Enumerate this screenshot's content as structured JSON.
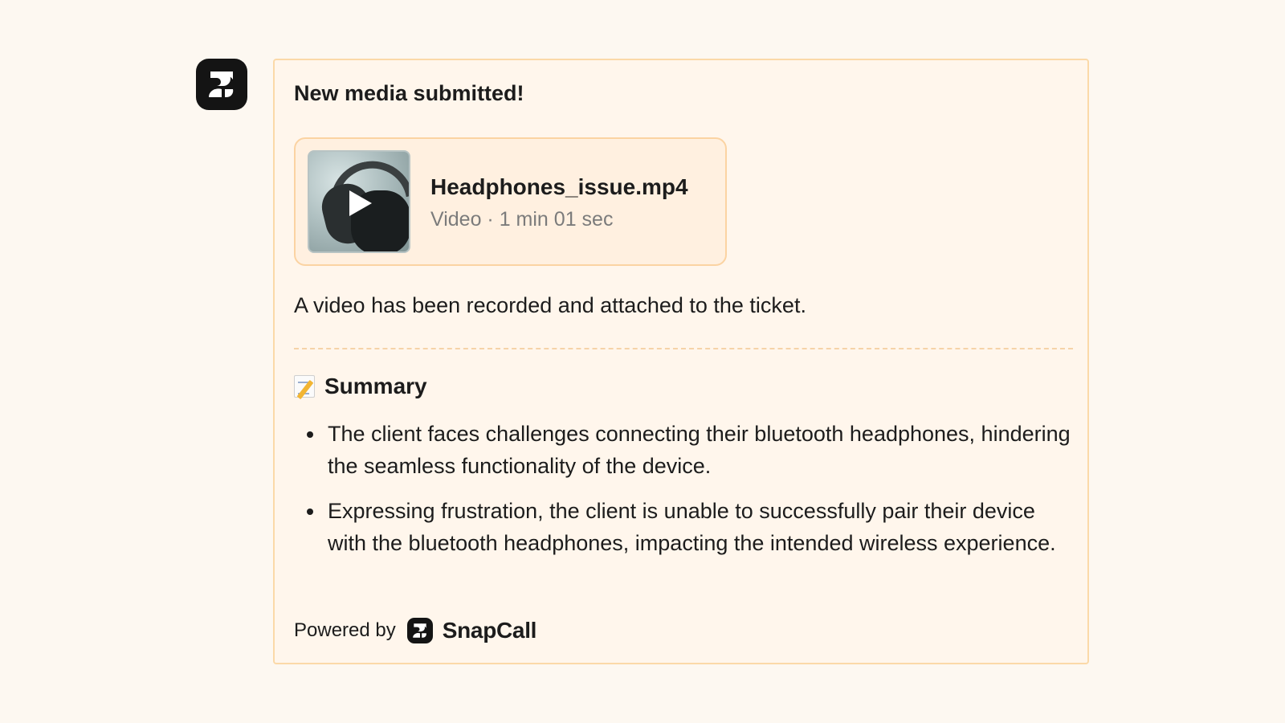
{
  "title": "New media submitted!",
  "media": {
    "file_name": "Headphones_issue.mp4",
    "meta": "Video · 1 min 01 sec",
    "thumbnail_icon": "play-icon"
  },
  "description": "A video has been recorded and attached to the ticket.",
  "summary": {
    "icon": "memo-icon",
    "heading": "Summary",
    "items": [
      "The client faces challenges connecting their bluetooth headphones, hindering the seamless functionality of the device.",
      "Expressing frustration, the client is unable to successfully pair their device with the bluetooth headphones, impacting the intended wireless experience."
    ]
  },
  "footer": {
    "powered_by": "Powered by",
    "brand": "SnapCall"
  },
  "colors": {
    "background": "#fdf8f1",
    "card_background": "#fff6ec",
    "card_border": "#fbd9a8",
    "media_background": "#fff0e0",
    "logo": "#141414"
  }
}
